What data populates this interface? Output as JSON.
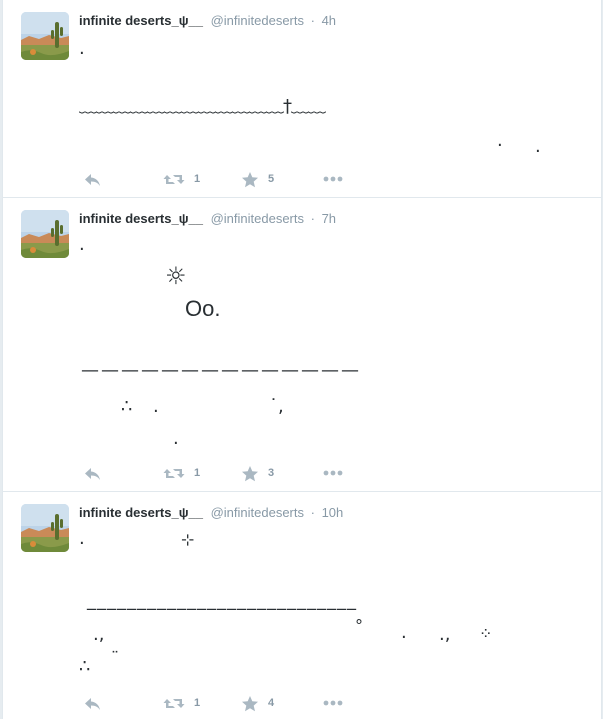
{
  "tweets": [
    {
      "name": "infinite deserts_ψ__",
      "handle": "@infinitedeserts",
      "sep": "·",
      "time": "4h",
      "lines": [
        ".",
        "﹏﹏﹏﹏﹏﹏﹏﹏﹏﹏﹏﹏†﹏﹏",
        ".",
        "."
      ],
      "retweets": "1",
      "favorites": "5"
    },
    {
      "name": "infinite deserts_ψ__",
      "handle": "@infinitedeserts",
      "sep": "·",
      "time": "7h",
      "lines": [
        ".",
        "☼",
        "Oo.",
        "——————————————",
        "∴",
        ".",
        "˙,",
        "."
      ],
      "retweets": "1",
      "favorites": "3"
    },
    {
      "name": "infinite deserts_ψ__",
      "handle": "@infinitedeserts",
      "sep": "·",
      "time": "10h",
      "lines": [
        ".",
        "⊹",
        "___________________________",
        ".,",
        "°",
        ".",
        ".,",
        "⁘",
        "∴",
        "¨"
      ],
      "retweets": "1",
      "favorites": "4"
    }
  ],
  "icons": {
    "reply": "reply-icon",
    "retweet": "retweet-icon",
    "favorite": "star-icon",
    "more": "more-icon"
  },
  "colors": {
    "action_gray": "#aab8c2",
    "count_gray": "#8899a6",
    "text": "#292f33"
  }
}
